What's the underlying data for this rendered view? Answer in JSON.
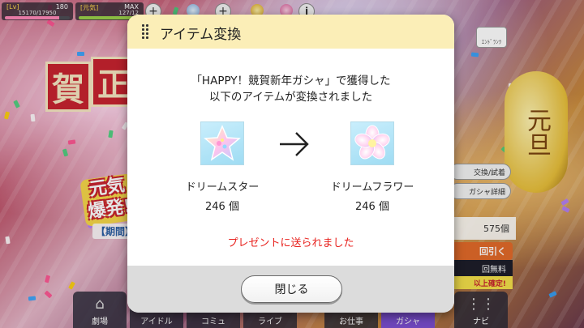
{
  "status_bar": {
    "level": {
      "label": "[Lv]",
      "value": "180",
      "exp": "15170/17950"
    },
    "stamina": {
      "label": "[元気]",
      "value": "MAX",
      "sub": "127/12"
    }
  },
  "background": {
    "banner_left": "賀",
    "banner_right": "正",
    "logo_line1": "元気",
    "logo_line2": "爆発!",
    "period": "【期間】",
    "lantern": "元旦"
  },
  "side_panel": {
    "ticket_label": "ｴﾝﾄﾞﾗﾝﾂ",
    "exchange_button": "交換/試着",
    "gacha_detail_button": "ガシャ詳細",
    "count": "575個",
    "draw_button": "回引く",
    "free_label": "回無料",
    "guaranteed_label": "以上確定!"
  },
  "bottom_nav": {
    "items": [
      {
        "label": "劇場",
        "icon": "theater-icon"
      },
      {
        "label": "アイドル",
        "icon": "idol-icon"
      },
      {
        "label": "コミュ",
        "icon": "commu-icon"
      },
      {
        "label": "ライブ",
        "icon": "live-icon"
      },
      {
        "label": "お仕事",
        "icon": "work-icon"
      },
      {
        "label": "ガシャ",
        "icon": "gacha-icon"
      },
      {
        "label": "ナビ",
        "icon": "navi-icon"
      }
    ]
  },
  "modal": {
    "title": "アイテム変換",
    "message_line1": "「HAPPY！競賀新年ガシャ」で獲得した",
    "message_line2": "以下のアイテムが変換されました",
    "from_item": {
      "name": "ドリームスター",
      "quantity": "246 個",
      "icon": "dream-star-icon"
    },
    "to_item": {
      "name": "ドリームフラワー",
      "quantity": "246 個",
      "icon": "dream-flower-icon"
    },
    "notice": "プレゼントに送られました",
    "close_button": "閉じる"
  },
  "colors": {
    "modal_header": "#fbeeb7",
    "notice_red": "#e8231f",
    "gacha_active": "#7b4fd0"
  }
}
